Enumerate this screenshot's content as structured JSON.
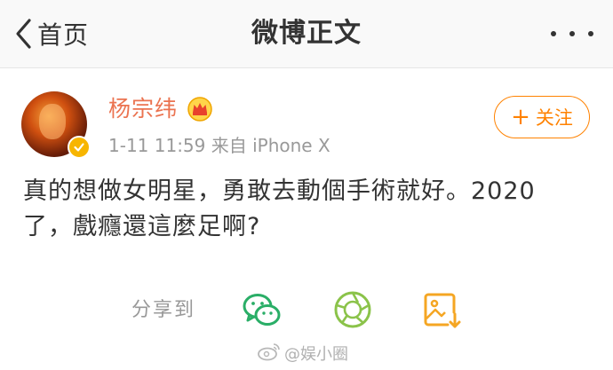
{
  "header": {
    "back_label": "首页",
    "title": "微博正文"
  },
  "post": {
    "author": "杨宗纬",
    "meta": "1-11 11:59  来自 iPhone X",
    "follow_label": "关注",
    "follow_plus": "+",
    "text": "真的想做女明星，勇敢去動個手術就好。2020了，戲癮還這麼足啊?"
  },
  "share": {
    "label": "分享到",
    "targets": [
      "wechat-icon",
      "moments-icon",
      "save-image-icon"
    ]
  },
  "watermark": {
    "text": "@娱小圈"
  },
  "colors": {
    "accent_orange": "#ff8200",
    "username": "#eb7350",
    "wechat_green": "#2aae67",
    "moments_green": "#8bc34a",
    "verified_gold": "#f7b500"
  }
}
